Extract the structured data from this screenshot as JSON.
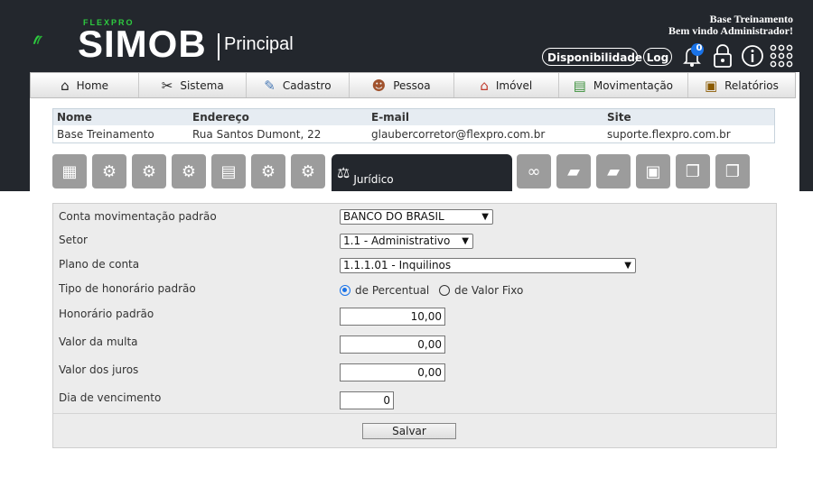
{
  "header": {
    "brand_small": "FLEXPRO",
    "brand": "SIMOB",
    "section": "Principal",
    "company": "Base Treinamento",
    "greeting": "Bem vindo Administrador!",
    "availability_label": "Disponibilidade",
    "log_label": "Log",
    "notification_count": "0"
  },
  "menu": [
    {
      "label": "Home",
      "icon": "home-icon"
    },
    {
      "label": "Sistema",
      "icon": "tools-icon"
    },
    {
      "label": "Cadastro",
      "icon": "pencil-icon"
    },
    {
      "label": "Pessoa",
      "icon": "person-icon"
    },
    {
      "label": "Imóvel",
      "icon": "house-icon"
    },
    {
      "label": "Movimentação",
      "icon": "money-icon"
    },
    {
      "label": "Relatórios",
      "icon": "clipboard-icon"
    }
  ],
  "info_table": {
    "headers": [
      "Nome",
      "Endereço",
      "E-mail",
      "Site"
    ],
    "row": [
      "Base Treinamento",
      "Rua Santos Dumont, 22",
      "glaubercorretor@flexpro.com.br",
      "suporte.flexpro.com.br"
    ]
  },
  "tabs": {
    "active_label": "Jurídico"
  },
  "form": {
    "conta_label": "Conta movimentação padrão",
    "conta_value": "BANCO DO BRASIL",
    "setor_label": "Setor",
    "setor_value": "1.1 - Administrativo",
    "plano_label": "Plano de conta",
    "plano_value": "1.1.1.01 - Inquilinos",
    "tipo_label": "Tipo de honorário padrão",
    "tipo_opt1": "de Percentual",
    "tipo_opt2": "de Valor Fixo",
    "honorario_label": "Honorário padrão",
    "honorario_value": "10,00",
    "multa_label": "Valor da multa",
    "multa_value": "0,00",
    "juros_label": "Valor dos juros",
    "juros_value": "0,00",
    "vencimento_label": "Dia de vencimento",
    "vencimento_value": "0",
    "save_label": "Salvar"
  }
}
